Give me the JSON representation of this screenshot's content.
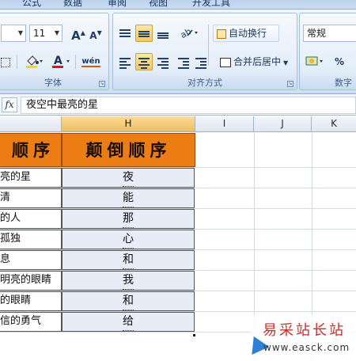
{
  "ribbon": {
    "tabs": [
      "公式",
      "数据",
      "审阅",
      "视图",
      "开发工具"
    ],
    "font": {
      "size": "11",
      "group_label": "字体",
      "grow_font": "A",
      "shrink_font": "A",
      "phonetic": "wén"
    },
    "alignment": {
      "wrap_text": "自动换行",
      "merge_center": "合并后居中",
      "group_label": "对齐方式"
    },
    "number": {
      "format": "常规",
      "percent": "%",
      "group_label": "数字"
    }
  },
  "formula_bar": {
    "fx_label": "fx",
    "value": "夜空中最亮的星"
  },
  "columns": [
    {
      "label": "",
      "selected": false
    },
    {
      "label": "H",
      "selected": true
    },
    {
      "label": "I",
      "selected": false
    },
    {
      "label": "J",
      "selected": false
    },
    {
      "label": "K",
      "selected": false
    }
  ],
  "sheet": {
    "header_left": "顺序",
    "header_h": "颠倒顺序",
    "rows": [
      {
        "g": "亮的星",
        "h": "夜"
      },
      {
        "g": "清",
        "h": "能"
      },
      {
        "g": "的人",
        "h": "那"
      },
      {
        "g": "孤独",
        "h": "心"
      },
      {
        "g": "息",
        "h": "和"
      },
      {
        "g": "明亮的眼睛",
        "h": "我"
      },
      {
        "g": "的眼睛",
        "h": "和"
      },
      {
        "g": "信的勇气",
        "h": "给"
      }
    ]
  },
  "watermark": {
    "line1": "易采站长站",
    "line2": "www.easck.com"
  },
  "colors": {
    "header_fill": "#ec7d15",
    "selected_fill": "#e8ecf6",
    "ribbon": "#dde9f7"
  }
}
